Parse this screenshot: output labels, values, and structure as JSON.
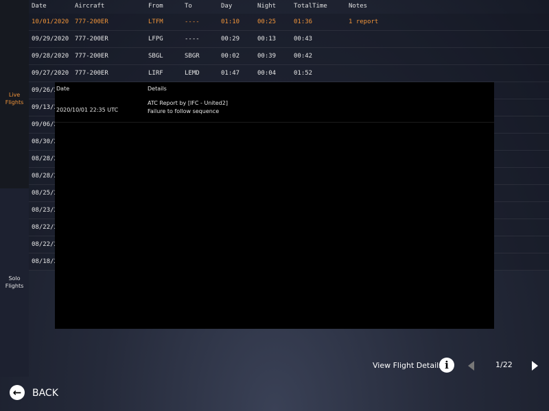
{
  "sidebar": {
    "live_label": "Live Flights",
    "solo_label_1": "Solo",
    "solo_label_2": "Flights"
  },
  "logbook": {
    "headers": {
      "date": "Date",
      "aircraft": "Aircraft",
      "from": "From",
      "to": "To",
      "day": "Day",
      "night": "Night",
      "total": "TotalTime",
      "notes": "Notes"
    },
    "rows": [
      {
        "date": "10/01/2020",
        "aircraft": "777-200ER",
        "from": "LTFM",
        "to": "----",
        "day": "01:10",
        "night": "00:25",
        "total": "01:36",
        "notes": "1 report"
      },
      {
        "date": "09/29/2020",
        "aircraft": "777-200ER",
        "from": "LFPG",
        "to": "----",
        "day": "00:29",
        "night": "00:13",
        "total": "00:43",
        "notes": ""
      },
      {
        "date": "09/28/2020",
        "aircraft": "777-200ER",
        "from": "SBGL",
        "to": "SBGR",
        "day": "00:02",
        "night": "00:39",
        "total": "00:42",
        "notes": ""
      },
      {
        "date": "09/27/2020",
        "aircraft": "777-200ER",
        "from": "LIRF",
        "to": "LEMD",
        "day": "01:47",
        "night": "00:04",
        "total": "01:52",
        "notes": ""
      },
      {
        "date": "09/26/2"
      },
      {
        "date": "09/13/2"
      },
      {
        "date": "09/06/2"
      },
      {
        "date": "08/30/2"
      },
      {
        "date": "08/28/2"
      },
      {
        "date": "08/28/2"
      },
      {
        "date": "08/25/2"
      },
      {
        "date": "08/23/2"
      },
      {
        "date": "08/22/2"
      },
      {
        "date": "08/22/2"
      },
      {
        "date": "08/18/2"
      }
    ]
  },
  "atc_report": {
    "header_date": "Date",
    "header_details": "Details",
    "entry": {
      "date": "2020/10/01 22:35 UTC",
      "line1": "ATC Report by [IFC - United2]",
      "line2": "Failure to follow sequence"
    }
  },
  "footer": {
    "view_details_label": "View Flight Details",
    "page_indicator": "1/22",
    "back_label": "BACK"
  },
  "colors": {
    "accent": "#f0943a"
  },
  "icons": {
    "info": "info-icon",
    "prev": "chevron-left-icon",
    "next": "chevron-right-icon",
    "back": "back-arrow-icon"
  }
}
